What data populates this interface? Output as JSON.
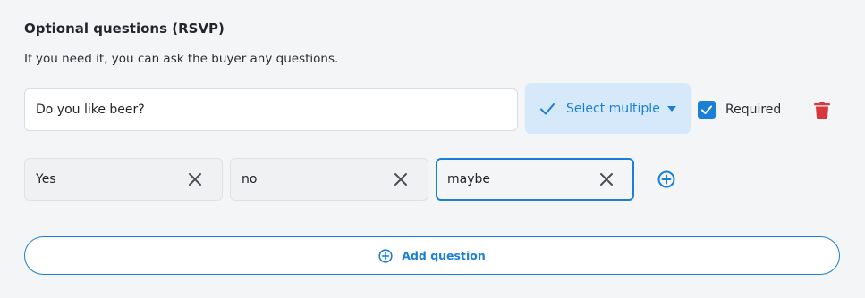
{
  "section": {
    "title": "Optional questions (RSVP)",
    "subtitle": "If you need it, you can ask the buyer any questions."
  },
  "question": {
    "value": "Do you like beer?",
    "type_label": "Select multiple",
    "required_label": "Required",
    "required_checked": true
  },
  "options": [
    {
      "value": "Yes"
    },
    {
      "value": "no"
    },
    {
      "value": "maybe"
    }
  ],
  "add_question_label": "Add question",
  "colors": {
    "accent": "#1a7fd6",
    "select_bg": "#d6e9fb",
    "delete": "#d9363e",
    "background": "#f4f5f7"
  },
  "icons": {
    "type_check": "check-icon",
    "dropdown": "caret-down-icon",
    "required_checkbox": "checkbox-checked-icon",
    "delete": "trash-icon",
    "remove_option": "close-icon",
    "add_option": "plus-circle-icon",
    "add_question": "plus-circle-icon"
  }
}
